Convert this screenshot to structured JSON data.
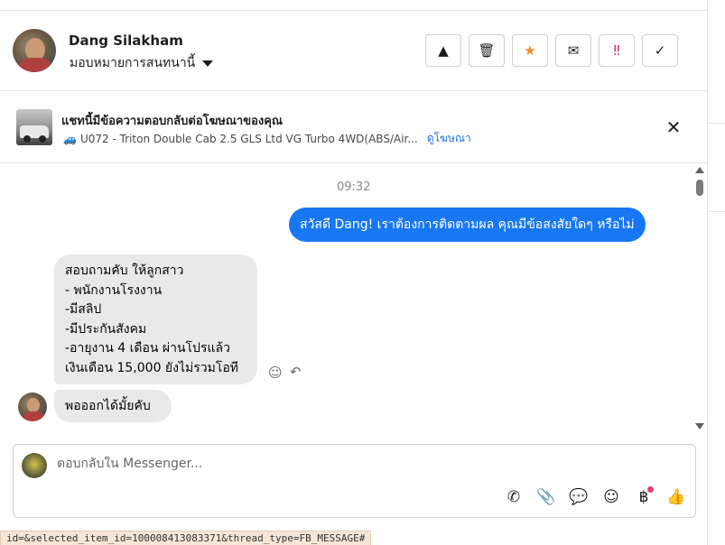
{
  "header": {
    "contact_name": "Dang Silakham",
    "assign_label": "มอบหมายการสนทนานี้",
    "actions": [
      {
        "name": "report-button",
        "icon": "warning-icon",
        "glyph": "▲",
        "color": "#1c1e21"
      },
      {
        "name": "delete-button",
        "icon": "trash-icon",
        "glyph": "🗑",
        "color": "#1c1e21"
      },
      {
        "name": "star-button",
        "icon": "star-icon",
        "glyph": "★",
        "color": "#f28c28"
      },
      {
        "name": "mark-unread-button",
        "icon": "envelope-icon",
        "glyph": "✉",
        "color": "#1c1e21"
      },
      {
        "name": "follow-up-button",
        "icon": "double-exclamation-icon",
        "glyph": "‼",
        "color": "#e0245e"
      },
      {
        "name": "mark-done-button",
        "icon": "check-icon",
        "glyph": "✓",
        "color": "#1c1e21"
      }
    ]
  },
  "ad_banner": {
    "title": "แชทนี้มีข้อความตอบกลับต่อโฆษณาของคุณ",
    "vehicle_emoji": "🚙",
    "listing": "U072 - Triton Double Cab 2.5 GLS Ltd VG Turbo 4WD(ABS/Air...",
    "view_ad_link": "ดูโฆษณา",
    "close_glyph": "✕"
  },
  "thread": {
    "timestamp": "09:32",
    "outgoing_message": "สวัสดี Dang! เราต้องการติดตามผล คุณมีข้อสงสัยใดๆ หรือไม่",
    "incoming_message_1": [
      "สอบถามคับ ให้ลูกสาว",
      "- พนักงานโรงงาน",
      "-มีสลิป",
      "-มีประกันสังคม",
      "-อายุงาน 4 เดือน  ผ่านโปรแล้ว",
      "เงินเดือน 15,000 ยังไม่รวมโอที"
    ],
    "incoming_message_2": "พอออกได้มั้ยคับ",
    "react_glyph": "☺",
    "reply_glyph": "↶"
  },
  "composer": {
    "placeholder": "ตอบกลับใน Messenger...",
    "tools": [
      {
        "name": "call-icon",
        "glyph": "✆"
      },
      {
        "name": "paperclip-icon",
        "glyph": "📎"
      },
      {
        "name": "saved-replies-icon",
        "glyph": "💬"
      },
      {
        "name": "emoji-icon",
        "glyph": "☺"
      },
      {
        "name": "payment-baht-icon",
        "glyph": "฿"
      },
      {
        "name": "thumbs-up-icon",
        "glyph": "👍"
      }
    ]
  },
  "status_bar": {
    "url_fragment": "id=&selected_item_id=100008413083371&thread_type=FB_MESSAGE#"
  },
  "colors": {
    "accent": "#1877f2",
    "incoming_bubble": "#e9e9eb",
    "link": "#216fdb",
    "notification_dot": "#e4405f"
  }
}
